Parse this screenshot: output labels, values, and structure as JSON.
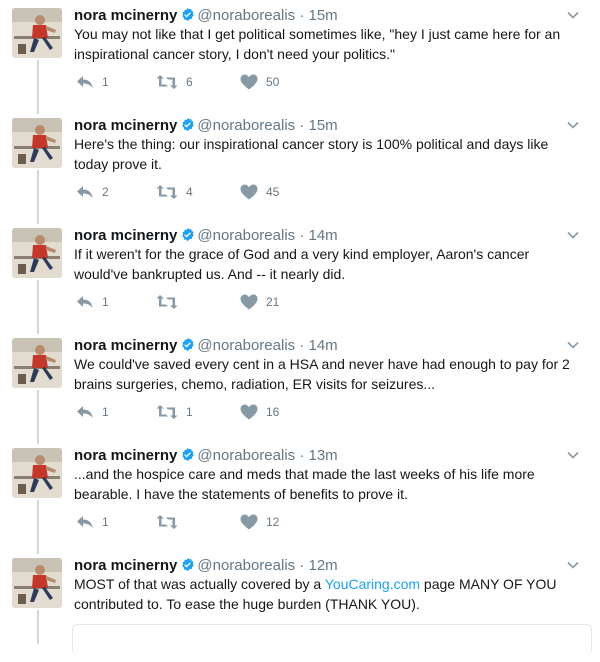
{
  "author": {
    "name": "nora mcinerny",
    "handle": "@noraborealis",
    "verified": true,
    "avatar": "profile-photo"
  },
  "colors": {
    "thread_line": "#ccd6dd",
    "link": "#1da1f2",
    "verified_badge": "#1da1f2",
    "secondary_text": "#657786"
  },
  "tweets": [
    {
      "time": "15m",
      "text": "You may not like that I get political sometimes like, \"hey I just came here for an inspirational cancer story, I don't need your politics.\"",
      "replies": "1",
      "retweets": "6",
      "likes": "50"
    },
    {
      "time": "15m",
      "text": "Here's the thing: our inspirational cancer story is 100% political and days like today prove it.",
      "replies": "2",
      "retweets": "4",
      "likes": "45"
    },
    {
      "time": "14m",
      "text": "If it weren't for the grace of God and a very kind employer, Aaron's cancer would've bankrupted us. And -- it nearly did.",
      "replies": "1",
      "retweets": "",
      "likes": "21"
    },
    {
      "time": "14m",
      "text": "We could've saved every cent in a HSA and never have had enough to pay for 2 brains surgeries, chemo, radiation, ER visits for seizures...",
      "replies": "1",
      "retweets": "1",
      "likes": "16"
    },
    {
      "time": "13m",
      "text": "...and the hospice care and meds that made the last weeks of his life more bearable. I have the statements of benefits to prove it.",
      "replies": "1",
      "retweets": "",
      "likes": "12"
    },
    {
      "time": "12m",
      "text_before": "MOST of that was actually covered by a ",
      "link": "YouCaring.com",
      "text_after": " page MANY OF YOU contributed to. To ease the huge burden (THANK YOU).",
      "replies": "",
      "retweets": "",
      "likes": ""
    }
  ]
}
